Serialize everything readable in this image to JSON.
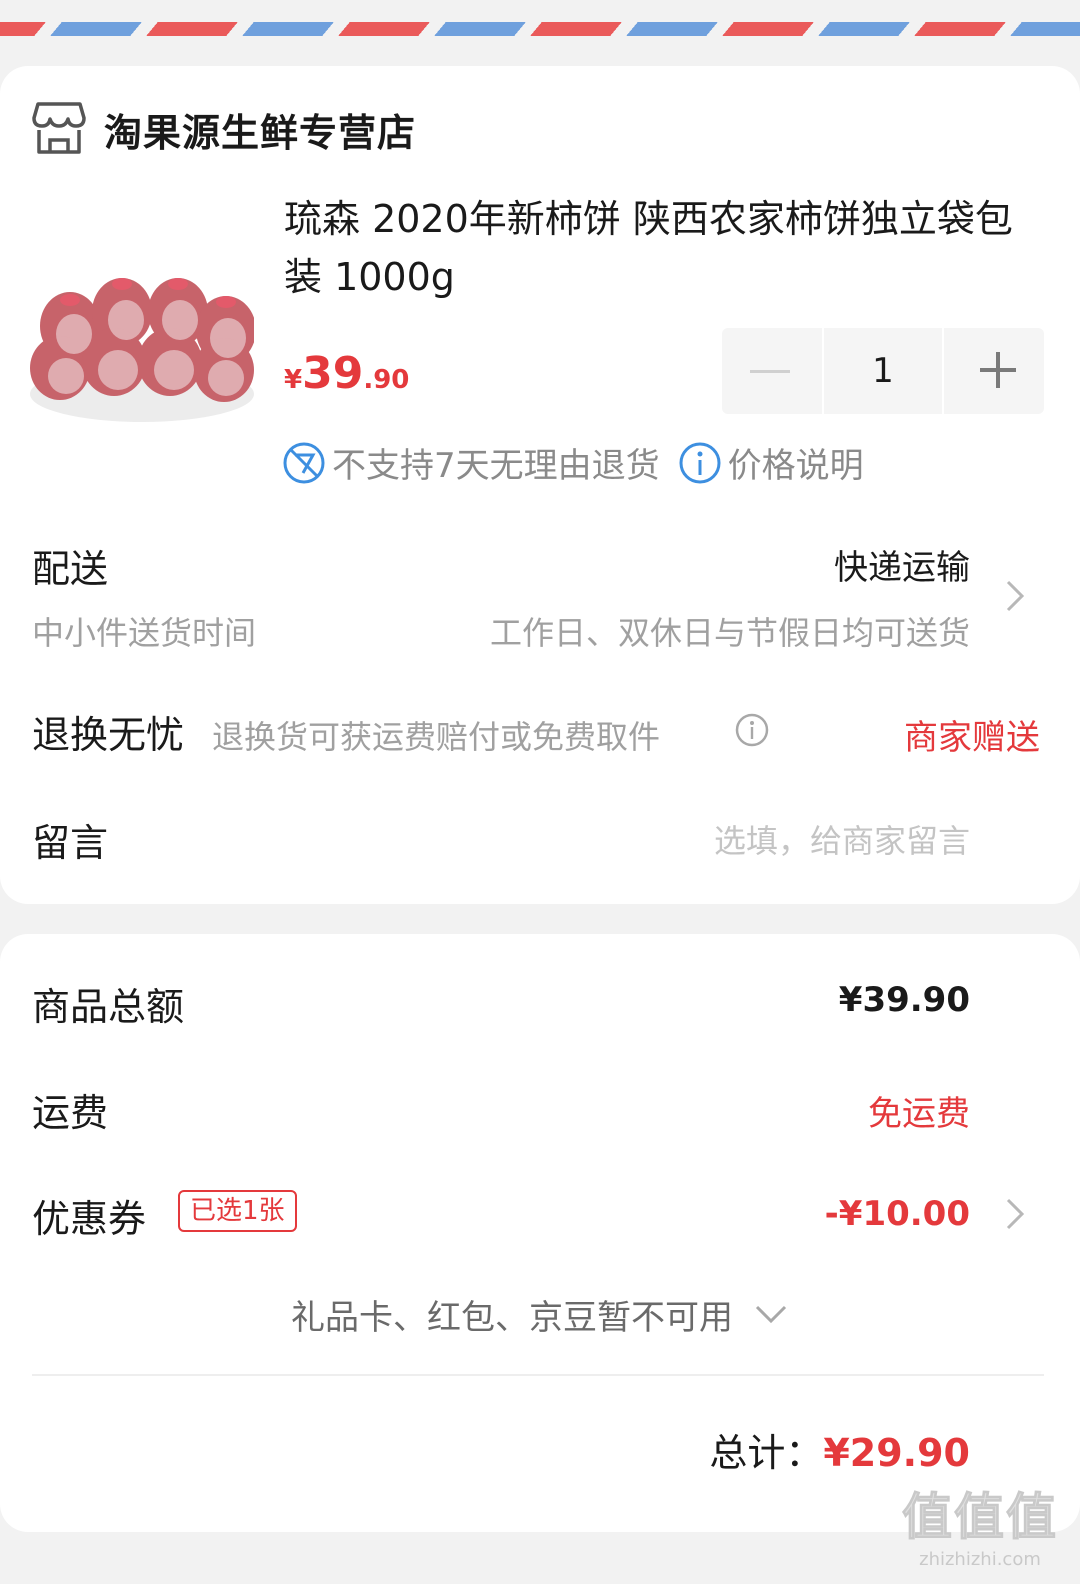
{
  "colors": {
    "accent": "#e4393c",
    "stripe_red": "#ea5a5a",
    "stripe_blue": "#6fa0dd",
    "muted": "#a0a0a0"
  },
  "store": {
    "name": "淘果源生鲜专营店",
    "icon": "store-icon"
  },
  "product": {
    "title": "琉森 2020年新柿饼 陕西农家柿饼独立袋包装 1000g",
    "price_symbol": "¥",
    "price_int": "39",
    "price_dec": ".90",
    "quantity": "1",
    "note_no_return": "不支持7天无理由退货",
    "note_price": "价格说明"
  },
  "delivery": {
    "label": "配送",
    "value": "快递运输",
    "sub_label": "中小件送货时间",
    "sub_value": "工作日、双休日与节假日均可送货"
  },
  "return": {
    "label": "退换无忧",
    "desc": "退换货可获运费赔付或免费取件",
    "value": "商家赠送"
  },
  "message": {
    "label": "留言",
    "placeholder": "选填，给商家留言"
  },
  "summary": {
    "goods_label": "商品总额",
    "goods_value": "¥39.90",
    "shipping_label": "运费",
    "shipping_value": "免运费",
    "coupon_label": "优惠券",
    "coupon_badge": "已选1张",
    "coupon_value": "-¥10.00",
    "gift_text": "礼品卡、红包、京豆暂不可用",
    "total_label": "总计：",
    "total_value": "¥29.90"
  },
  "watermark": {
    "logo": "值值值",
    "url": "zhizhizhi.com"
  }
}
